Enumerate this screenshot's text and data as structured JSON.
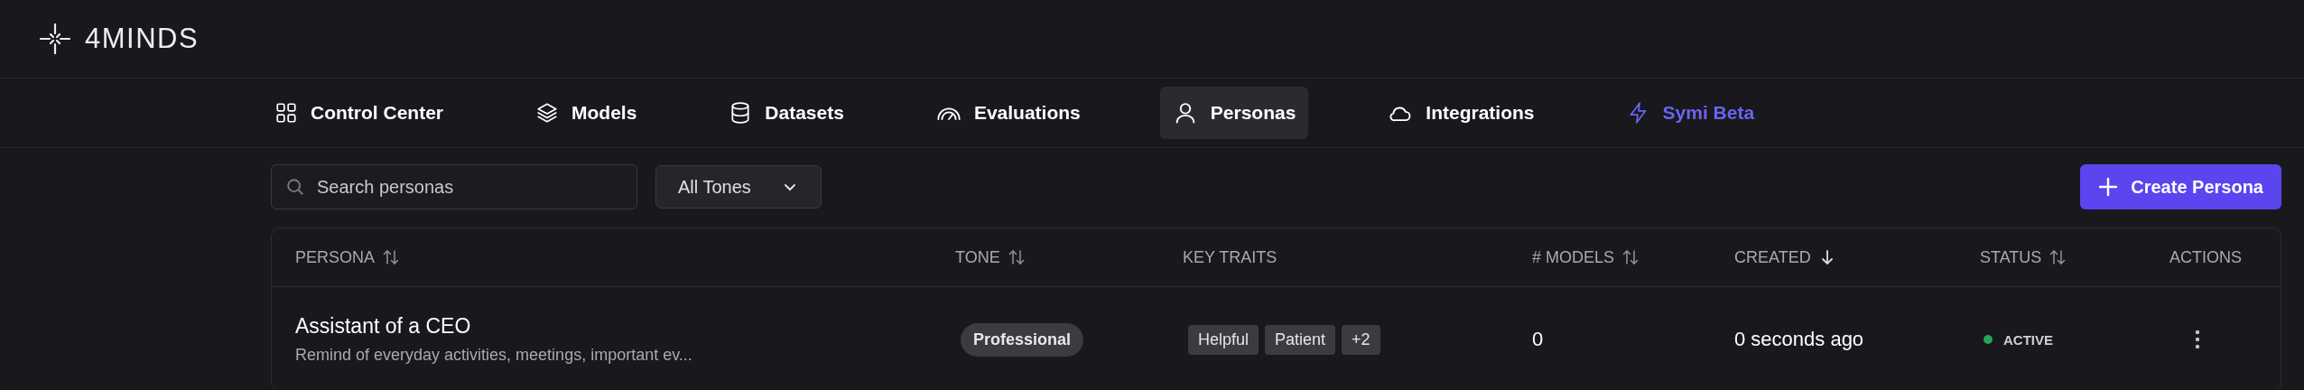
{
  "brand": {
    "name": "4MINDS"
  },
  "nav": [
    {
      "label": "Control Center",
      "selected": false,
      "accent": false
    },
    {
      "label": "Models",
      "selected": false,
      "accent": false
    },
    {
      "label": "Datasets",
      "selected": false,
      "accent": false
    },
    {
      "label": "Evaluations",
      "selected": false,
      "accent": false
    },
    {
      "label": "Personas",
      "selected": true,
      "accent": false
    },
    {
      "label": "Integrations",
      "selected": false,
      "accent": false
    },
    {
      "label": "Symi Beta",
      "selected": false,
      "accent": true
    }
  ],
  "toolbar": {
    "search": {
      "placeholder": "Search personas"
    },
    "tone_filter": {
      "value": "All Tones"
    },
    "create_button": "Create Persona"
  },
  "table": {
    "columns": [
      {
        "label": "PERSONA",
        "sortable": true,
        "sorted": false
      },
      {
        "label": "TONE",
        "sortable": true,
        "sorted": false
      },
      {
        "label": "KEY TRAITS",
        "sortable": false
      },
      {
        "label": "# MODELS",
        "sortable": true,
        "sorted": false
      },
      {
        "label": "CREATED",
        "sortable": true,
        "sorted": true
      },
      {
        "label": "STATUS",
        "sortable": true,
        "sorted": false
      },
      {
        "label": "ACTIONS",
        "sortable": false
      }
    ],
    "rows": [
      {
        "name": "Assistant of a CEO",
        "description": "Remind of everyday activities, meetings, important ev...",
        "tone": "Professional",
        "traits": [
          "Helpful",
          "Patient",
          "+2"
        ],
        "models": "0",
        "created": "0 seconds ago",
        "status": "ACTIVE",
        "color": "#22a55a"
      }
    ]
  }
}
